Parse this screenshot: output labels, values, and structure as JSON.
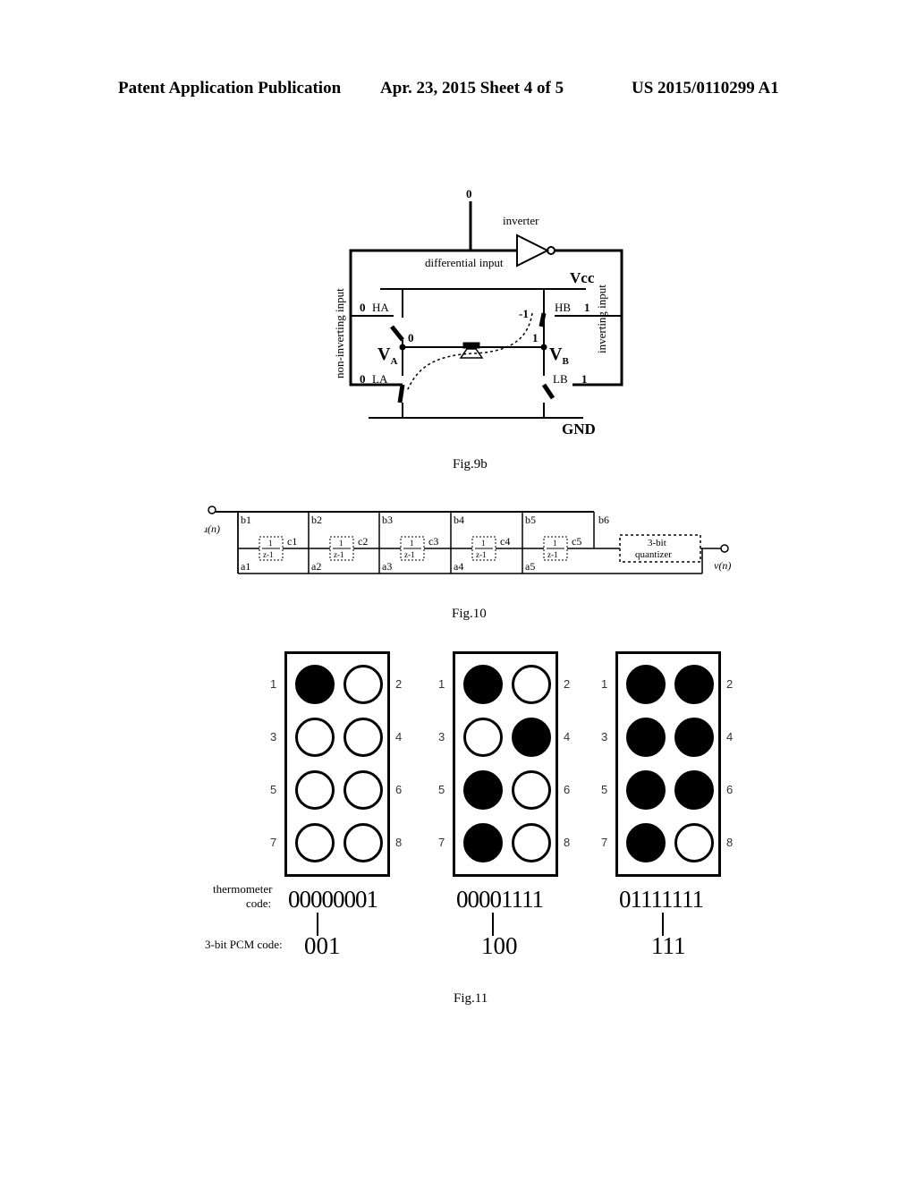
{
  "header": {
    "publication": "Patent Application Publication",
    "date_sheet": "Apr. 23, 2015  Sheet 4 of 5",
    "number": "US 2015/0110299 A1"
  },
  "fig9b": {
    "caption": "Fig.9b",
    "top_value": "0",
    "inverter_label": "inverter",
    "differential_input_label": "differential input",
    "vcc_label": "Vcc",
    "gnd_label": "GND",
    "non_inverting_input_label": "non-inverting input",
    "inverting_input_label": "inverting input",
    "ha": {
      "label": "HA",
      "value": "0"
    },
    "la": {
      "label": "LA",
      "value": "0"
    },
    "hb": {
      "label": "HB",
      "value": "1"
    },
    "lb": {
      "label": "LB",
      "value": "1"
    },
    "va": {
      "label": "V",
      "sub": "A",
      "value": "0"
    },
    "vb": {
      "label": "V",
      "sub": "B",
      "value": "1"
    },
    "current_label": "-1"
  },
  "fig10": {
    "caption": "Fig.10",
    "input_label": "u(n)",
    "output_label": "v(n)",
    "quantizer_line1": "3-bit",
    "quantizer_line2": "quantizer",
    "integrator_num": "1",
    "integrator_den": "z-1",
    "b_labels": [
      "b1",
      "b2",
      "b3",
      "b4",
      "b5",
      "b6"
    ],
    "c_labels": [
      "c1",
      "c2",
      "c3",
      "c4",
      "c5"
    ],
    "a_labels": [
      "a1",
      "a2",
      "a3",
      "a4",
      "a5"
    ]
  },
  "fig11": {
    "caption": "Fig.11",
    "thermometer_label_line1": "thermometer",
    "thermometer_label_line2": "code:",
    "pcm_label": "3-bit PCM code:",
    "panels": [
      {
        "filled": [
          1,
          0,
          0,
          0,
          0,
          0,
          0,
          0
        ],
        "thermometer": "00000001",
        "pcm": "001"
      },
      {
        "filled": [
          1,
          0,
          0,
          1,
          1,
          0,
          1,
          0
        ],
        "thermometer": "00001111",
        "pcm": "100"
      },
      {
        "filled": [
          1,
          1,
          1,
          1,
          1,
          1,
          1,
          0
        ],
        "thermometer": "01111111",
        "pcm": "111"
      }
    ],
    "dot_numbers": [
      "1",
      "2",
      "3",
      "4",
      "5",
      "6",
      "7",
      "8"
    ]
  }
}
